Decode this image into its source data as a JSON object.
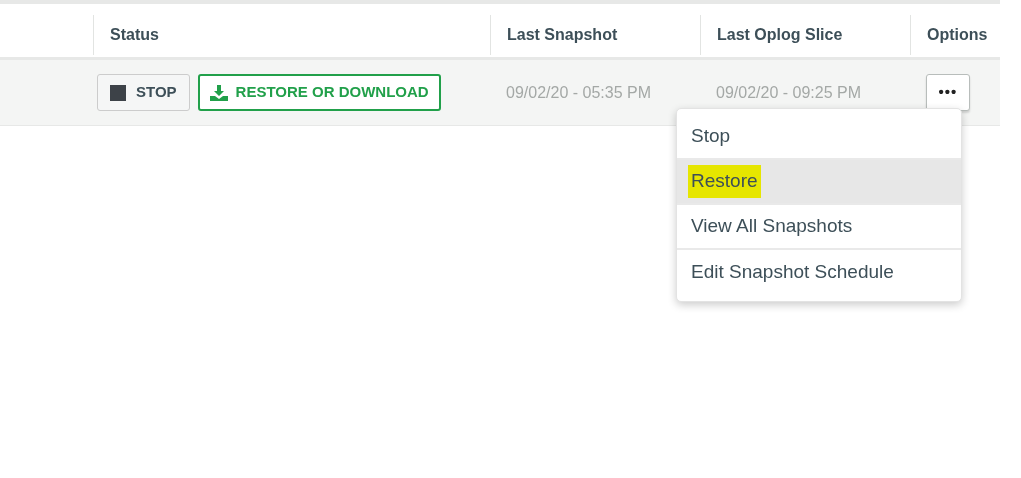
{
  "table": {
    "columns": [
      {
        "label": "Status"
      },
      {
        "label": "Last Snapshot"
      },
      {
        "label": "Last Oplog Slice"
      },
      {
        "label": "Options"
      }
    ],
    "rows": [
      {
        "stop_button": "STOP",
        "restore_button": "RESTORE OR DOWNLOAD",
        "last_snapshot": "09/02/20 - 05:35 PM",
        "last_oplog_slice": "09/02/20 - 09:25 PM",
        "options_button": "•••"
      }
    ]
  },
  "options_menu": {
    "items": [
      {
        "label": "Stop",
        "selected": false,
        "highlighted": false
      },
      {
        "label": "Restore",
        "selected": true,
        "highlighted": true
      },
      {
        "label": "View All Snapshots",
        "selected": false,
        "highlighted": false
      },
      {
        "label": "Edit Snapshot Schedule",
        "selected": false,
        "highlighted": false
      }
    ]
  }
}
